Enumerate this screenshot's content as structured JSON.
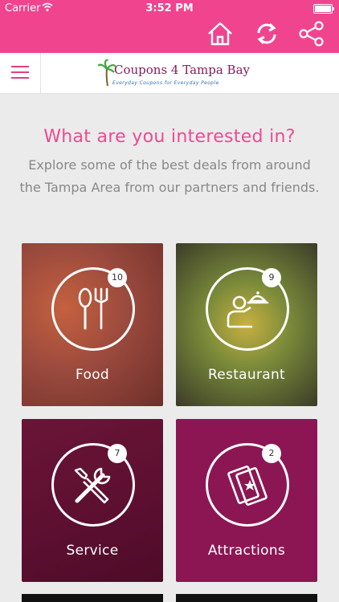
{
  "status_bar": {
    "carrier": "Carrier",
    "time": "3:52 PM"
  },
  "toolbar": {
    "icons": [
      "home-icon",
      "refresh-icon",
      "share-icon"
    ]
  },
  "header": {
    "logo_text": "Coupons 4 Tampa Bay",
    "logo_tagline": "Everyday Coupons for Everyday People"
  },
  "intro": {
    "title": "What are you interested in?",
    "text": "Explore some of the best deals from around the Tampa Area from our partners and friends."
  },
  "categories": [
    {
      "label": "Food",
      "count": "10",
      "icon": "fork-spoon-icon",
      "color": "#9b4a3e"
    },
    {
      "label": "Restaurant",
      "count": "9",
      "icon": "waiter-icon",
      "color": "#6f7a3a"
    },
    {
      "label": "Service",
      "count": "7",
      "icon": "tools-icon",
      "color": "#5c0f30"
    },
    {
      "label": "Attractions",
      "count": "2",
      "icon": "tickets-icon",
      "color": "#8c1654"
    }
  ],
  "colors": {
    "brand": "#f0448f",
    "accent_text": "#ee4a92"
  }
}
